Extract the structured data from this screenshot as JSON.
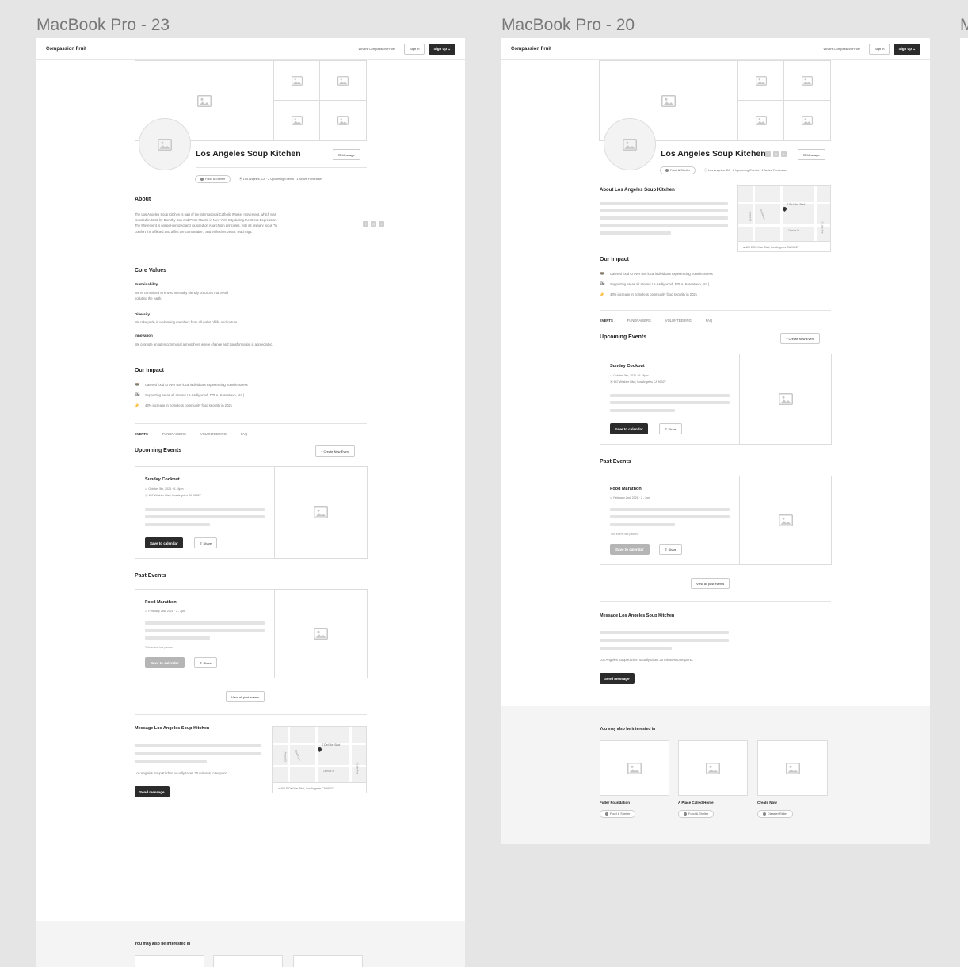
{
  "frames": [
    {
      "label": "MacBook Pro - 23"
    },
    {
      "label": "MacBook Pro - 20"
    },
    {
      "label": "M"
    }
  ],
  "nav": {
    "brand": "Compassion Fruit",
    "link": "What's Compassion Fruit?",
    "signin": "Sign in",
    "signup": "Sign up",
    "signup_icon": "chevron-down-icon"
  },
  "org": {
    "name": "Los Angeles Soup Kitchen",
    "message_btn": "Message",
    "category": "Food & Shelter",
    "location": "Los Angeles, CA",
    "stats_a": "2 Upcoming Events · 1 Active Fundraiser",
    "stats_b": "2 Upcoming Events · 1 Active Fundraiser"
  },
  "about": {
    "heading": "About",
    "heading_b": "About Los Angeles Soup Kitchen",
    "body": "The Los Angeles Soup Kitchen is part of the international Catholic Worker movement, which was founded in 1933 by Dorothy Day and Peter Maurin in New York City during the Great Depression. The Movement is gospel-itemized and founded on Anarchism principles, with its primary focus \"to comfort the afflicted and afflict the comfortable,\" and enfleshes Jesus' teachings."
  },
  "core_values": {
    "heading": "Core Values",
    "items": [
      {
        "title": "Sustainability",
        "body": "We're committed to environmentally friendly practices that avoid polluting the earth."
      },
      {
        "title": "Diversity",
        "body": "We take pride in welcoming members from all walks of life and culture."
      },
      {
        "title": "Innovation",
        "body": "We promote an open communal atmosphere where change and transformation is appreciated."
      }
    ]
  },
  "impact": {
    "heading": "Our Impact",
    "items": [
      {
        "icon": "🍲",
        "text": "Catered food to over 500 local individuals experiencing homelessness"
      },
      {
        "icon": "🏙",
        "text": "Supporting areas all around LA (Hollywood, DTLA, Koreatown, etc.)"
      },
      {
        "icon": "🍌",
        "text": "43% increase in homeless community food security in 2021"
      }
    ]
  },
  "tabs": [
    "EVENTS",
    "FUNDRAISERS",
    "VOLUNTEERING",
    "FAQ"
  ],
  "events": {
    "upcoming_heading": "Upcoming Events",
    "create_btn": "+ Create New Event",
    "upcoming": {
      "title": "Sunday Cookout",
      "date": "October 5th, 2021 · 6 - 8pm",
      "address": "647 Wilshire Blvd, Los Angeles CA 90027",
      "save_btn": "Save to calendar",
      "share_btn": "Share"
    },
    "past_heading": "Past Events",
    "past": {
      "title": "Food Marathon",
      "date": "February 2nd, 2021 · 2 - 3pm",
      "passed": "This event has passed.",
      "save_btn": "Save to calendar",
      "share_btn": "Share"
    },
    "view_all": "View all past events"
  },
  "message": {
    "heading": "Message Los Angeles Soup Kitchen",
    "note": "Los Angeles Soup Kitchen usually takes 30 minutes to respond.",
    "send_btn": "Send message"
  },
  "map": {
    "street_a": "E Del Mar Blvd",
    "street_b": "Oneida St",
    "street_c": "Euclid Ave",
    "street_d": "S Lake Ave",
    "street_e": "Arroyo Dr",
    "address": "400 E Del Mar Blvd, Los Angeles CA 90027"
  },
  "recommend": {
    "heading": "You may also be interested in",
    "items": [
      {
        "name": "Fuller Foundation",
        "tag": "Food & Shelter"
      },
      {
        "name": "A Place Called Home",
        "tag": "Food & Shelter"
      },
      {
        "name": "Create Now",
        "tag": "Disaster Relief"
      }
    ]
  },
  "colors": {
    "dark": "#2b2b2b",
    "bg": "#e5e5e5",
    "placeholder": "#dcdcdc"
  }
}
